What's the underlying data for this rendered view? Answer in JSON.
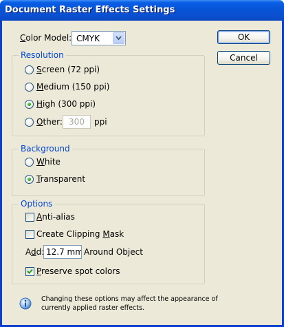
{
  "window": {
    "title": "Document Raster Effects Settings"
  },
  "color_model": {
    "label_pre": "",
    "label_u": "C",
    "label_post": "olor Model:",
    "value": "CMYK"
  },
  "buttons": {
    "ok": "OK",
    "cancel": "Cancel"
  },
  "resolution": {
    "title": "Resolution",
    "options": {
      "screen": {
        "u": "S",
        "rest": "creen (72 ppi)",
        "selected": false
      },
      "medium": {
        "u": "M",
        "rest": "edium (150 ppi)",
        "selected": false
      },
      "high": {
        "u": "H",
        "rest": "igh (300 ppi)",
        "selected": true
      },
      "other": {
        "u": "O",
        "rest": "ther:",
        "selected": false,
        "value": "300",
        "unit": "ppi"
      }
    }
  },
  "background": {
    "title": "Background",
    "options": {
      "white": {
        "u": "W",
        "rest": "hite",
        "selected": false
      },
      "transparent": {
        "u": "T",
        "rest": "ransparent",
        "selected": true
      }
    }
  },
  "options": {
    "title": "Options",
    "anti_alias": {
      "u": "A",
      "rest": "nti-alias",
      "checked": false
    },
    "clipping_mask": {
      "pre": "Create Clipping ",
      "u": "M",
      "rest": "ask",
      "checked": false
    },
    "add": {
      "pre": "A",
      "u": "d",
      "rest": "d:",
      "value": "12.7 mm",
      "suffix": "Around Object"
    },
    "preserve_spot": {
      "u": "P",
      "rest": "reserve spot colors",
      "checked": true
    }
  },
  "info": {
    "icon": "info-icon",
    "line1": "Changing these options may affect the appearance of",
    "line2": "currently applied raster effects."
  }
}
